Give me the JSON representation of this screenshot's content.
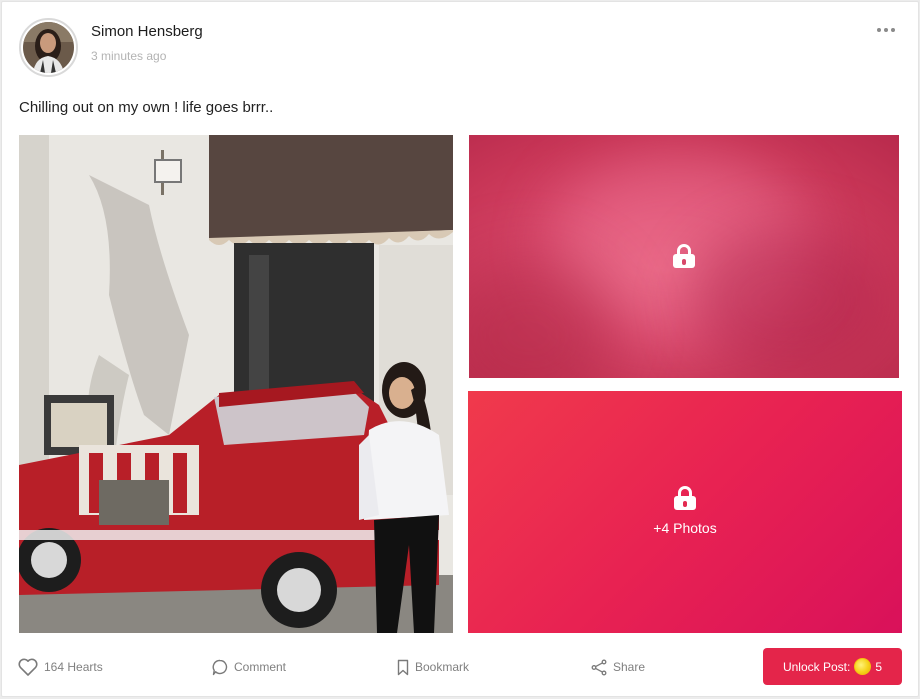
{
  "post": {
    "author_name": "Simon Hensberg",
    "timestamp": "3 minutes ago",
    "caption": "Chilling out on my own ! life goes brrr.."
  },
  "media": {
    "main_photo_icon": "photo",
    "locked_icon": "lock-icon",
    "more_photos_label": "+4 Photos"
  },
  "actions": {
    "hearts_label": "164 Hearts",
    "comment_label": "Comment",
    "bookmark_label": "Bookmark",
    "share_label": "Share",
    "unlock_label": "Unlock Post:",
    "unlock_price": "5"
  },
  "colors": {
    "accent": "#e4254a",
    "locked_gradient_start": "#f03a4c",
    "locked_gradient_end": "#d9115a"
  }
}
